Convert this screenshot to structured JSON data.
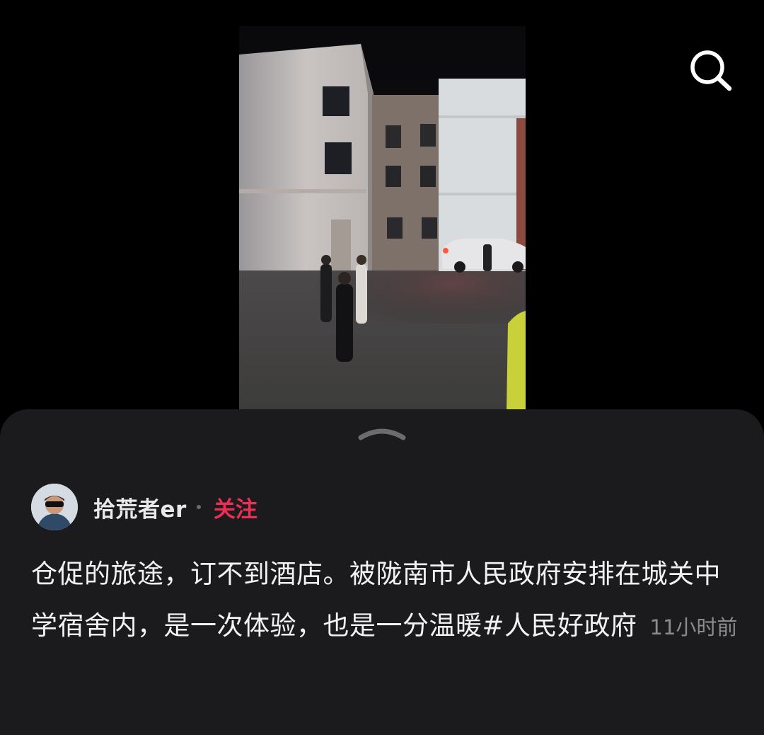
{
  "post": {
    "author": "拾荒者er",
    "separator": "·",
    "follow_label": "关注",
    "caption": "仓促的旅途，订不到酒店。被陇南市人民政府安排在城关中学宿舍内，是一次体验，也是一分温暖#人民好政府",
    "time": "11小时前"
  },
  "icons": {
    "search": "search-icon",
    "handle": "chevron-up-icon",
    "avatar": "avatar"
  },
  "colors": {
    "background": "#000000",
    "sheet": "#1b1b1d",
    "follow": "#f12d55",
    "muted": "#8b8b8f"
  }
}
